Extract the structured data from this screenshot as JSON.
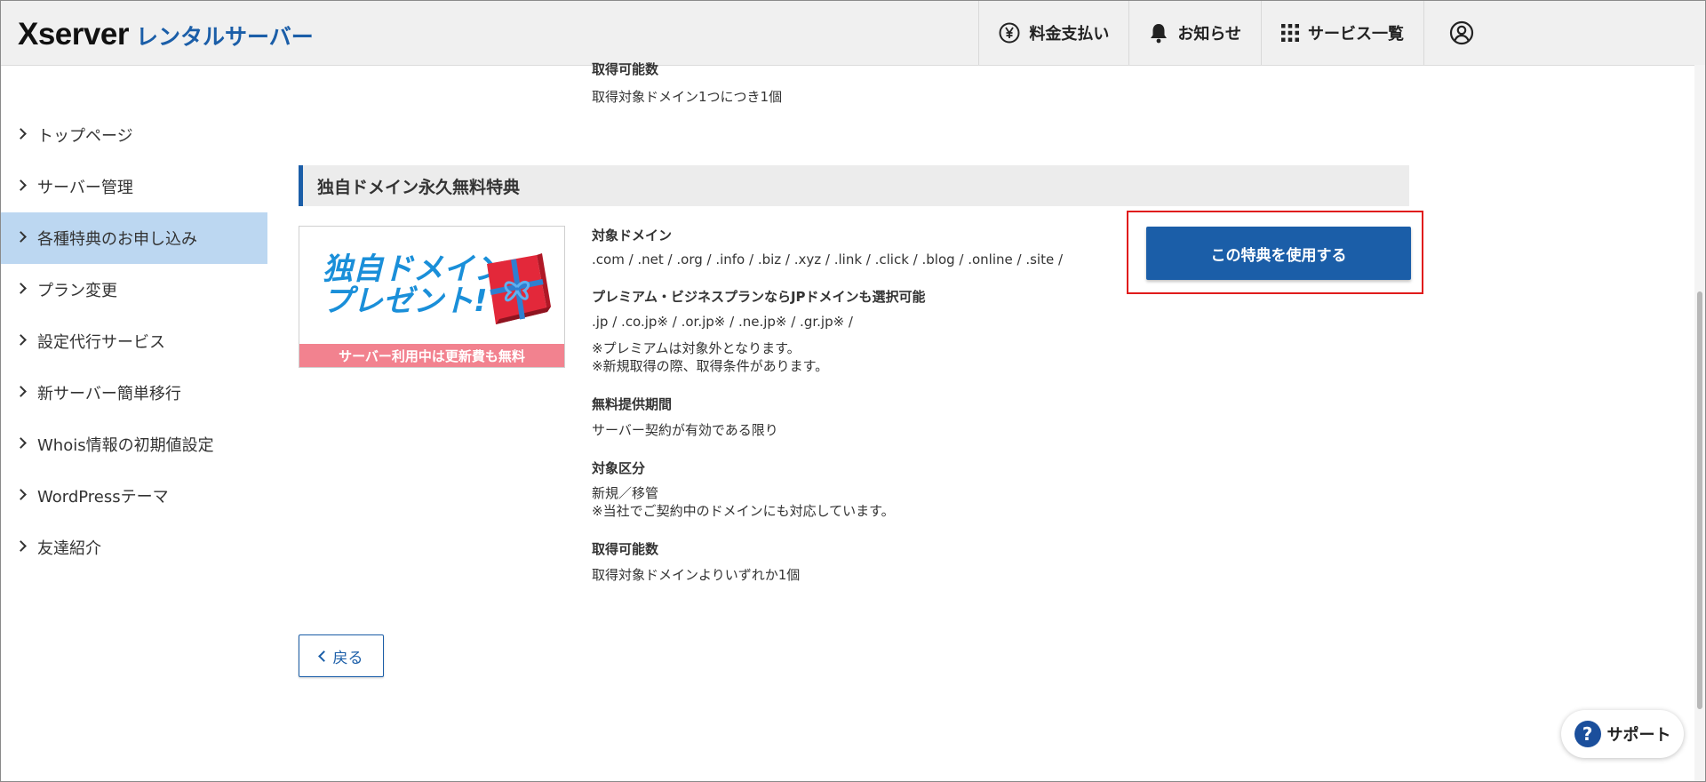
{
  "header": {
    "logo_main": "Xserver",
    "logo_sub": "レンタルサーバー",
    "nav": [
      {
        "label": "料金支払い",
        "icon": "yen-circle-icon"
      },
      {
        "label": "お知らせ",
        "icon": "bell-icon"
      },
      {
        "label": "サービス一覧",
        "icon": "grid-icon"
      }
    ],
    "user_icon": "user-circle-icon"
  },
  "sidebar": {
    "items": [
      {
        "label": "トップページ"
      },
      {
        "label": "サーバー管理"
      },
      {
        "label": "各種特典のお申し込み",
        "active": true
      },
      {
        "label": "プラン変更"
      },
      {
        "label": "設定代行サービス"
      },
      {
        "label": "新サーバー簡単移行"
      },
      {
        "label": "Whois情報の初期値設定"
      },
      {
        "label": "WordPressテーマ"
      },
      {
        "label": "友達紹介"
      }
    ]
  },
  "main": {
    "prev_section": {
      "label": "取得可能数",
      "value": "取得対象ドメイン1つにつき1個"
    },
    "section_title": "独自ドメイン永久無料特典",
    "banner": {
      "line1": "独自ドメイン",
      "line2": "プレゼント!",
      "footer": "サーバー利用中は更新費も無料"
    },
    "details": {
      "target_domain_label": "対象ドメイン",
      "target_domain_value": ".com / .net / .org / .info / .biz / .xyz / .link / .click / .blog / .online / .site /",
      "premium_label": "プレミアム・ビジネスプランならJPドメインも選択可能",
      "premium_value": ".jp / .co.jp※ / .or.jp※ / .ne.jp※ / .gr.jp※ /",
      "premium_note1": "※プレミアムは対象外となります。",
      "premium_note2": "※新規取得の際、取得条件があります。",
      "period_label": "無料提供期間",
      "period_value": "サーバー契約が有効である限り",
      "category_label": "対象区分",
      "category_value1": "新規／移管",
      "category_value2": "※当社でご契約中のドメインにも対応しています。",
      "count_label": "取得可能数",
      "count_value": "取得対象ドメインよりいずれか1個"
    },
    "cta_label": "この特典を使用する",
    "back_label": "戻る"
  },
  "support": {
    "label": "サポート",
    "icon_glyph": "?"
  },
  "colors": {
    "accent": "#1b5ea8",
    "active_bg": "#bcd7f1",
    "highlight": "#e01b1b",
    "banner_pink": "#f2828f"
  }
}
